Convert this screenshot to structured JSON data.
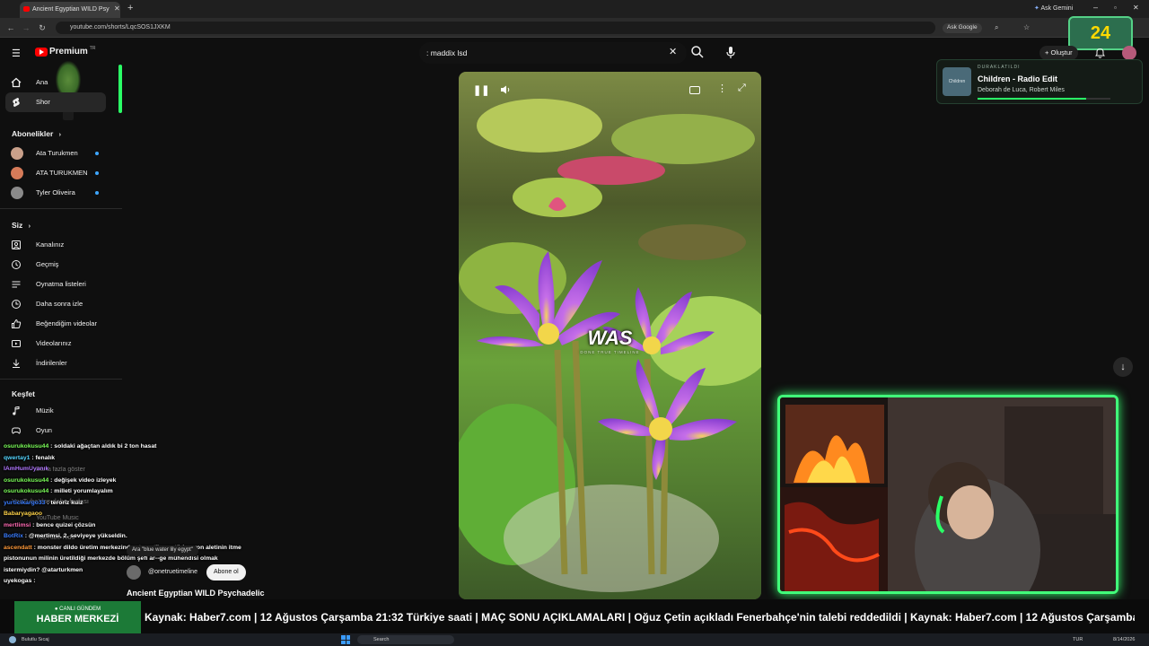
{
  "browser": {
    "tab_title": "Ancient Egyptian WILD Psy",
    "url": "youtube.com/shorts/LqcSOS1JXKM",
    "ask_gemini": "Ask Gemini",
    "ask_google": "Ask Google"
  },
  "youtube": {
    "logo_text": "Premium",
    "logo_sup": "TR",
    "search_query": ": maddix lsd",
    "create_label": "Oluştur"
  },
  "sidebar": {
    "top_items": [
      {
        "label": "Ana",
        "icon": "home-icon"
      },
      {
        "label": "Shor",
        "icon": "shorts-icon"
      }
    ],
    "subscriptions_heading": "Abonelikler",
    "subscriptions": [
      {
        "label": "Ata Turukmen",
        "avatar_color": "#c9a08a"
      },
      {
        "label": "ATA TURUKMEN",
        "avatar_color": "#d67b59"
      },
      {
        "label": "Tyler Oliveira",
        "avatar_color": "#8a8a8a"
      }
    ],
    "you_heading": "Siz",
    "you_items": [
      {
        "label": "Kanalınız",
        "icon": "channel-icon"
      },
      {
        "label": "Geçmiş",
        "icon": "history-icon"
      },
      {
        "label": "Oynatma listeleri",
        "icon": "playlist-icon"
      },
      {
        "label": "Daha sonra izle",
        "icon": "watch-later-icon"
      },
      {
        "label": "Beğendiğim videolar",
        "icon": "like-icon"
      },
      {
        "label": "Videolarınız",
        "icon": "your-videos-icon"
      },
      {
        "label": "İndirilenler",
        "icon": "download-icon"
      }
    ],
    "explore_heading": "Keşfet",
    "explore_items": [
      {
        "label": "Müzik",
        "icon": "music-icon"
      },
      {
        "label": "Oyun",
        "icon": "gaming-icon"
      }
    ]
  },
  "video": {
    "caption": "WAS",
    "watermark": "DONE TRUE TIMELINE",
    "title": "Ancient Egyptian WILD Psychadelic",
    "channel": "@onetruetimeline",
    "subscribe_label": "Abone ol",
    "search_chip": "Ara \"blue water lily egypt\""
  },
  "now_playing": {
    "status": "DURAKLATILDI",
    "title": "Children - Radio Edit",
    "artist": "Deborah de Luca, Robert Miles",
    "art_text": "Children",
    "progress": 0.82
  },
  "overlay_timer": "24",
  "chat": [
    {
      "user": "osurukokusu44",
      "msg": ": soldaki ağaçtan aldık bi 2 ton hasat",
      "color": "#7cff5a"
    },
    {
      "user": "qwertay1",
      "msg": ": fenalık",
      "color": "#55d6ff"
    },
    {
      "user": "IAmHumUyanık",
      "msg": "",
      "color": "#b277ff"
    },
    {
      "user": "osurukokusu44",
      "msg": ": değişek video izleyek",
      "color": "#7cff5a"
    },
    {
      "user": "osurukokusu44",
      "msg": ": milleti yorumlayalım",
      "color": "#7cff5a"
    },
    {
      "user": "yurticikargo33",
      "msg": ": teroriz kuiz",
      "color": "#3a7dff"
    },
    {
      "user": "Babaryagaoo",
      "msg": "",
      "color": "#ffd34a"
    },
    {
      "user": "mertlimsi",
      "msg": ": bence quizei çözsün",
      "color": "#ff6ab3"
    },
    {
      "user": "BotRix",
      "msg": ": @mertimsi, 2. seviyeye yükseldin.",
      "color": "#3a7dff"
    },
    {
      "user": "ascendatt",
      "msg": ": monster dildo üretim merkezinde otomatik mastürbasyon aletinin itme",
      "color": "#ff9a3a"
    },
    {
      "user": "",
      "msg": "pistonunun milinin üretildiği merkezde bölüm şefi ar--ge mühendisi olmak",
      "color": "#ffffff"
    },
    {
      "user": "",
      "msg": "istermiydin? @atarturkmen",
      "color": "#ffffff"
    },
    {
      "user": "uyekogas",
      "msg": ":",
      "color": "#ffffff"
    }
  ],
  "sidebar_ghost": [
    "Daha fazla göster",
    "YouTube'dan daha fazlası",
    "YouTube Music",
    "YouTube Kids"
  ],
  "ticker": {
    "badge_top": "● CANLI GÜNDEM",
    "badge_main": "HABER MERKEZİ",
    "text": "Kaynak: Haber7.com | 12 Ağustos Çarşamba 21:32 Türkiye saati | MAÇ SONU AÇIKLAMALARI | Oğuz Çetin açıkladı Fenerbahçe'nin talebi reddedildi | Kaynak: Haber7.com | 12 Ağustos Çarşamba 21:10 Türkiye sa"
  },
  "taskbar": {
    "weather": "Bulutlu Sıcaj",
    "search": "Search",
    "lang": "TUR",
    "date": "8/14/2026"
  },
  "colors": {
    "accent_green": "#41ff7a",
    "yt_red": "#ff0000",
    "ticker_green": "#1c7a37"
  }
}
